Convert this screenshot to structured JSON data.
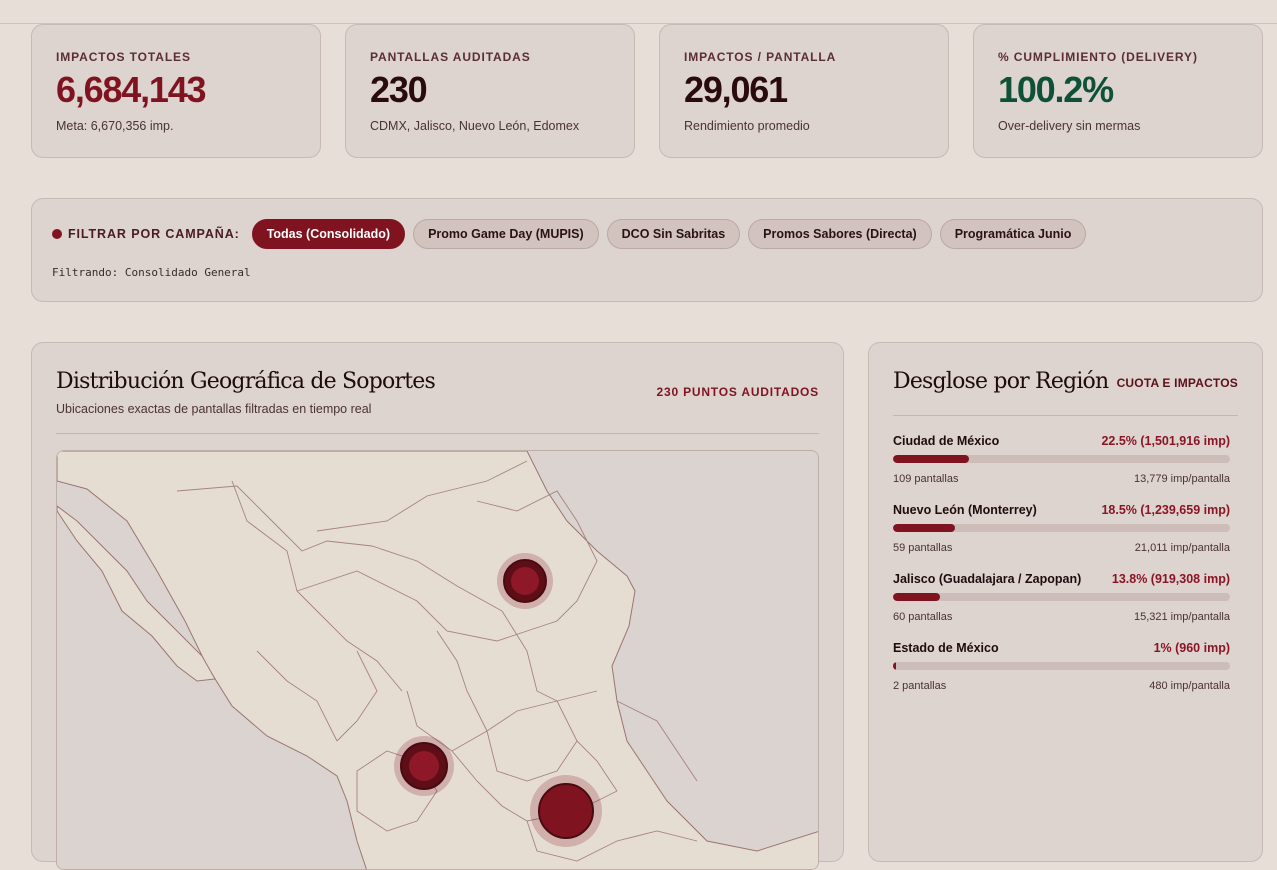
{
  "kpis": [
    {
      "label": "IMPACTOS TOTALES",
      "value": "6,684,143",
      "sub": "Meta: 6,670,356 imp.",
      "color": "#7f1420"
    },
    {
      "label": "PANTALLAS AUDITADAS",
      "value": "230",
      "sub": "CDMX, Jalisco, Nuevo León, Edomex",
      "color": "#2a0b0d"
    },
    {
      "label": "IMPACTOS / PANTALLA",
      "value": "29,061",
      "sub": "Rendimiento promedio",
      "color": "#2a0b0d"
    },
    {
      "label": "% CUMPLIMIENTO (DELIVERY)",
      "value": "100.2%",
      "sub": "Over-delivery sin mermas",
      "color": "#0f5138"
    }
  ],
  "filter": {
    "label": "FILTRAR POR CAMPAÑA:",
    "chips": [
      {
        "label": "Todas (Consolidado)",
        "active": true
      },
      {
        "label": "Promo Game Day (MUPIS)",
        "active": false
      },
      {
        "label": "DCO Sin Sabritas",
        "active": false
      },
      {
        "label": "Promos Sabores (Directa)",
        "active": false
      },
      {
        "label": "Programática Junio",
        "active": false
      }
    ],
    "status": "Filtrando: Consolidado General"
  },
  "map": {
    "title": "Distribución Geográfica de Soportes",
    "subtitle": "Ubicaciones exactas de pantallas filtradas en tiempo real",
    "badge": "230 PUNTOS AUDITADOS",
    "markers": [
      {
        "name": "Nuevo León (Monterrey)",
        "icon": "location-marker-icon"
      },
      {
        "name": "Jalisco (Guadalajara / Zapopan)",
        "icon": "location-marker-icon"
      },
      {
        "name": "Ciudad de México",
        "icon": "location-marker-icon"
      }
    ]
  },
  "regions": {
    "title": "Desglose por Región",
    "badge": "CUOTA E IMPACTOS",
    "items": [
      {
        "name": "Ciudad de México",
        "share": "22.5% (1,501,916 imp)",
        "pct": 22.5,
        "screens": "109 pantallas",
        "per_screen": "13,779 imp/pantalla"
      },
      {
        "name": "Nuevo León (Monterrey)",
        "share": "18.5% (1,239,659 imp)",
        "pct": 18.5,
        "screens": "59 pantallas",
        "per_screen": "21,011 imp/pantalla"
      },
      {
        "name": "Jalisco (Guadalajara / Zapopan)",
        "share": "13.8% (919,308 imp)",
        "pct": 13.8,
        "screens": "60 pantallas",
        "per_screen": "15,321 imp/pantalla"
      },
      {
        "name": "Estado de México",
        "share": "1% (960 imp)",
        "pct": 1,
        "screens": "2 pantallas",
        "per_screen": "480 imp/pantalla"
      }
    ]
  },
  "colors": {
    "accent": "#7f1420",
    "positive": "#0f5138",
    "background": "#e7ded8"
  }
}
